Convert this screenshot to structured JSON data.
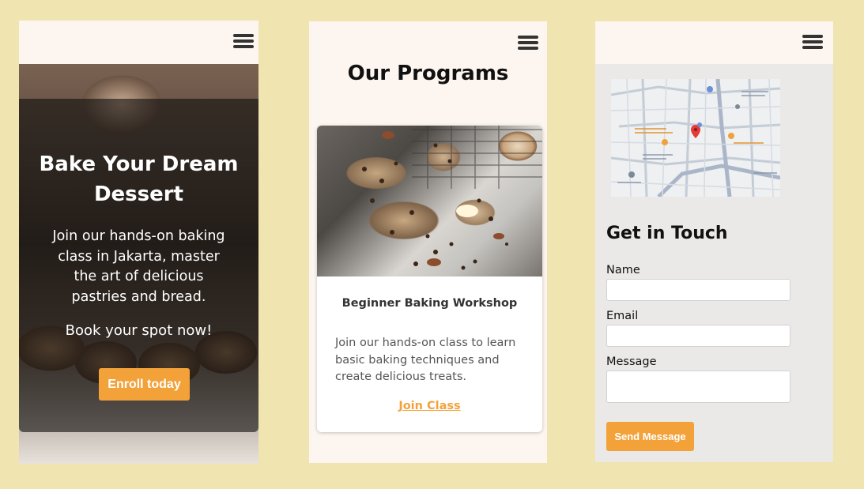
{
  "colors": {
    "page_background": "#f0e4b0",
    "accent": "#f3a23a",
    "header_background": "#fdf5ef",
    "form_background": "#ebe8e8"
  },
  "hero": {
    "menu_icon": "hamburger-menu-icon",
    "title": "Bake Your Dream Dessert",
    "text": "Join our hands-on baking class in Jakarta, master the art of delicious pastries and bread.",
    "cta_text": "Book your spot now!",
    "button_label": "Enroll today"
  },
  "programs": {
    "menu_icon": "hamburger-menu-icon",
    "title": "Our Programs",
    "card": {
      "title": "Beginner Baking Workshop",
      "description": "Join our hands-on class to learn basic baking techniques and create delicious treats.",
      "link_label": "Join Class"
    }
  },
  "contact": {
    "menu_icon": "hamburger-menu-icon",
    "title": "Get in Touch",
    "fields": {
      "name_label": "Name",
      "email_label": "Email",
      "message_label": "Message"
    },
    "button_label": "Send Message"
  }
}
